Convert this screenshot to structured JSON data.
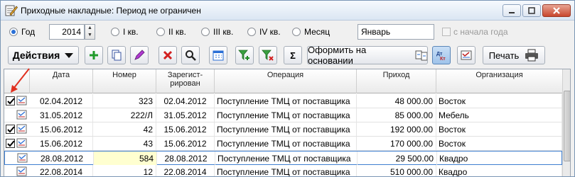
{
  "window": {
    "title": "Приходные накладные: Период не ограничен"
  },
  "period": {
    "year_label": "Год",
    "year_value": "2014",
    "q1_label": "I кв.",
    "q2_label": "II кв.",
    "q3_label": "III кв.",
    "q4_label": "IV кв.",
    "month_label": "Месяц",
    "month_value": "Январь",
    "from_start_label": "с начала года"
  },
  "toolbar": {
    "actions_label": "Действия",
    "create_based_label": "Оформить на основании",
    "print_label": "Печать",
    "sigma_label": "Σ"
  },
  "grid": {
    "headers": {
      "date": "Дата",
      "number": "Номер",
      "registered_l1": "Зарегист-",
      "registered_l2": "рирован",
      "operation": "Операция",
      "income": "Приход",
      "organization": "Организация"
    },
    "rows": [
      {
        "checked": true,
        "date": "02.04.2012",
        "number": "323",
        "registered": "02.04.2012",
        "operation": "Поступление  ТМЦ от поставщика",
        "income": "48 000.00",
        "organization": "Восток"
      },
      {
        "checked": false,
        "date": "31.05.2012",
        "number": "222/Л",
        "registered": "31.05.2012",
        "operation": "Поступление  ТМЦ от поставщика",
        "income": "85 000.00",
        "organization": "Мебель"
      },
      {
        "checked": true,
        "date": "15.06.2012",
        "number": "42",
        "registered": "15.06.2012",
        "operation": "Поступление  ТМЦ от поставщика",
        "income": "192 000.00",
        "organization": "Восток"
      },
      {
        "checked": true,
        "date": "15.06.2012",
        "number": "43",
        "registered": "15.06.2012",
        "operation": "Поступление  ТМЦ от поставщика",
        "income": "170 000.00",
        "organization": "Восток"
      },
      {
        "checked": false,
        "date": "28.08.2012",
        "number": "584",
        "registered": "28.08.2012",
        "operation": "Поступление  ТМЦ от поставщика",
        "income": "29 500.00",
        "organization": "Квадро"
      },
      {
        "checked": false,
        "date": "22.08.2014",
        "number": "12",
        "registered": "22.08.2014",
        "operation": "Поступление  ТМЦ от поставщика",
        "income": "510 000.00",
        "organization": "Квадро"
      }
    ]
  },
  "colors": {
    "accent": "#2a6fd6",
    "selection_border": "#3f7fd0",
    "highlight_cell": "#ffffd0",
    "arrow": "#e03020"
  }
}
